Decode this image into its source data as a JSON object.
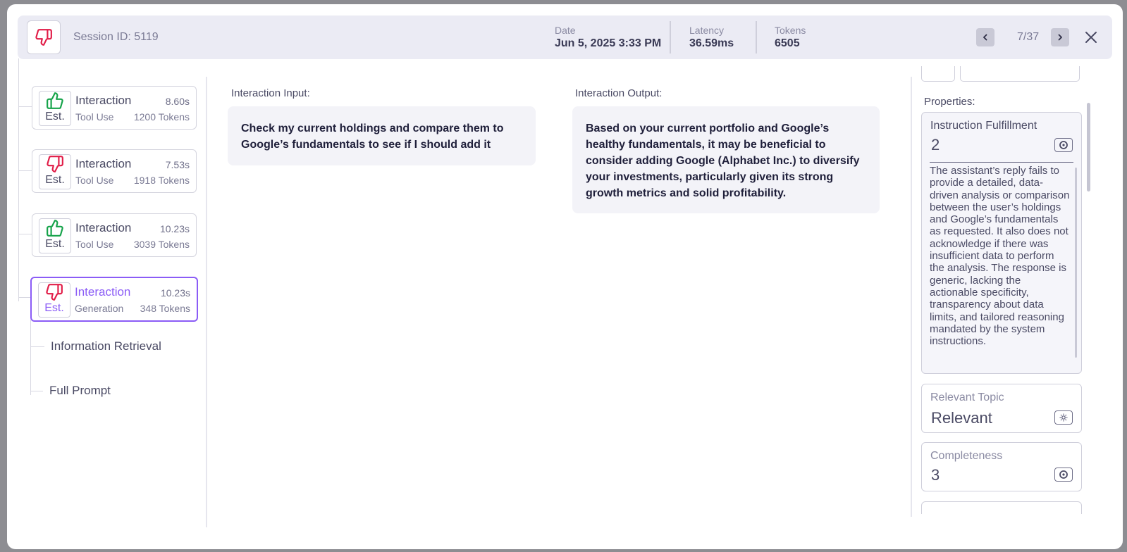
{
  "header": {
    "session_id": "Session ID: 5119",
    "date_label": "Date",
    "date_value": "Jun 5, 2025 3:33 PM",
    "latency_label": "Latency",
    "latency_value": "36.59ms",
    "tokens_label": "Tokens",
    "tokens_value": "6505",
    "pager": "7/37",
    "status_icon": "thumbs-down-icon"
  },
  "sidebar": {
    "interactions": [
      {
        "title": "Interaction",
        "duration": "8.60s",
        "kind": "Tool Use",
        "tokens": "1200 Tokens",
        "badge": "Est.",
        "rating": "thumbs-up"
      },
      {
        "title": "Interaction",
        "duration": "7.53s",
        "kind": "Tool Use",
        "tokens": "1918 Tokens",
        "badge": "Est.",
        "rating": "thumbs-down"
      },
      {
        "title": "Interaction",
        "duration": "10.23s",
        "kind": "Tool Use",
        "tokens": "3039 Tokens",
        "badge": "Est.",
        "rating": "thumbs-up"
      },
      {
        "title": "Interaction",
        "duration": "10.23s",
        "kind": "Generation",
        "tokens": "348 Tokens",
        "badge": "Est.",
        "rating": "thumbs-down",
        "active": true
      }
    ],
    "sub_items": [
      "Information Retrieval",
      "Full Prompt"
    ]
  },
  "main": {
    "input_label": "Interaction Input:",
    "input_text": "Check my current holdings and compare them to Google’s fundamentals to see if I should add it",
    "output_label": "Interaction Output:",
    "output_text": "Based on your current portfolio and Google’s healthy fundamentals, it may be beneficial to consider adding Google (Alphabet Inc.) to diversify your investments, particularly given its strong growth metrics and solid profitability."
  },
  "properties": {
    "label": "Properties:",
    "items": [
      {
        "name": "Instruction Fulfillment",
        "value": "2",
        "reason": "The assistant’s reply fails to provide a detailed, data-driven analysis or comparison between the user’s holdings and Google’s fundamentals as requested. It also does not acknowledge if there was insufficient data to perform the analysis. The response is generic, lacking the actionable specificity, transparency about data limits, and tailored reasoning mandated by the system instructions."
      },
      {
        "name": "Relevant Topic",
        "value": "Relevant"
      },
      {
        "name": "Completeness",
        "value": "3"
      }
    ]
  },
  "colors": {
    "accent": "#8b5cf6",
    "thumbs_up": "#16a34a",
    "thumbs_down": "#e11d48"
  }
}
